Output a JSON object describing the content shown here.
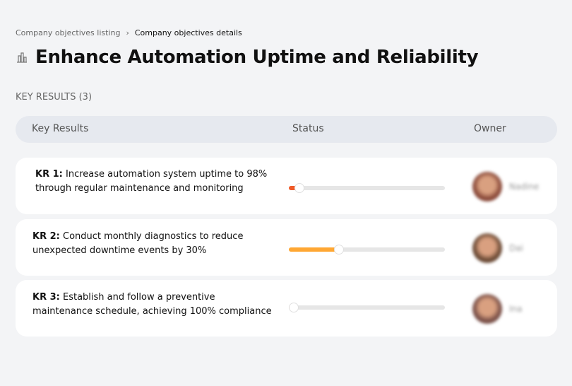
{
  "breadcrumb": {
    "parent": "Company objectives listing",
    "separator": "›",
    "current": "Company objectives details"
  },
  "title": "Enhance Automation Uptime and Reliability",
  "section_label": "KEY RESULTS (3)",
  "columns": {
    "key_results": "Key Results",
    "status": "Status",
    "owner": "Owner"
  },
  "key_results": [
    {
      "label": "KR 1:",
      "text": " Increase automation system uptime to 98% through regular maintenance and monitoring",
      "progress": 7,
      "color": "#f05a28",
      "owner": "Nadine"
    },
    {
      "label": "KR 2:",
      "text": " Conduct monthly diagnostics to reduce unexpected downtime events by 30%",
      "progress": 32,
      "color": "#ffa733",
      "owner": "Dai"
    },
    {
      "label": "KR 3:",
      "text": " Establish and follow a preventive maintenance schedule, achieving 100% compliance",
      "progress": 3,
      "color": "#f05a28",
      "owner": "Ina"
    }
  ]
}
